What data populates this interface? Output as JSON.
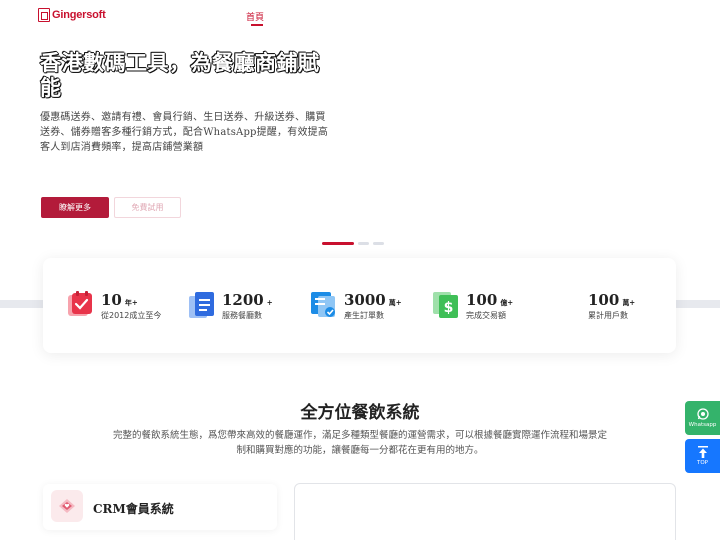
{
  "header": {
    "logo_text": "Gingersoft",
    "nav_home": "首頁"
  },
  "hero": {
    "title": "香港數碼工具，為餐廳商鋪賦能",
    "description": "優惠碼送券、邀請有禮、會員行銷、生日送券、升級送券、購買送券、儲券贈客多種行銷方式，配合WhatsApp提醒，有效提高客人到店消費頻率，提高店鋪營業額",
    "primary_button": "瞭解更多",
    "secondary_button": "免費試用"
  },
  "carousel": {
    "count": 3,
    "active": 0
  },
  "stats": [
    {
      "icon": "calendar-check-icon",
      "value": "10",
      "unit": "年+",
      "label": "從2012成立至今",
      "color": "#e8344a"
    },
    {
      "icon": "document-list-icon",
      "value": "1200",
      "unit": "+",
      "label": "服務餐廳數",
      "color": "#2f6bdf"
    },
    {
      "icon": "order-check-icon",
      "value": "3000",
      "unit": "萬+",
      "label": "產生訂單數",
      "color": "#1c8ce6"
    },
    {
      "icon": "dollar-document-icon",
      "value": "100",
      "unit": "億+",
      "label": "完成交易額",
      "color": "#3fbf57"
    },
    {
      "icon": "",
      "value": "100",
      "unit": "萬+",
      "label": "累計用戶數",
      "color": ""
    }
  ],
  "section": {
    "title": "全方位餐飲系統",
    "description": "完整的餐飲系統生態，爲您帶來高效的餐廳運作，滿足多種類型餐廳的運營需求，可以根據餐廳實際運作流程和場景定制和購買對應的功能，讓餐廳每一分都花在更有用的地方。"
  },
  "feature": {
    "label": "CRM會員系統",
    "icon": "heart-layers-icon"
  },
  "floating": {
    "whatsapp_label": "Whatsapp",
    "top_label": "TOP"
  },
  "colors": {
    "brand": "#c8102e",
    "primary_button": "#b31b3a",
    "whatsapp": "#34b36b",
    "top": "#1677ff"
  }
}
